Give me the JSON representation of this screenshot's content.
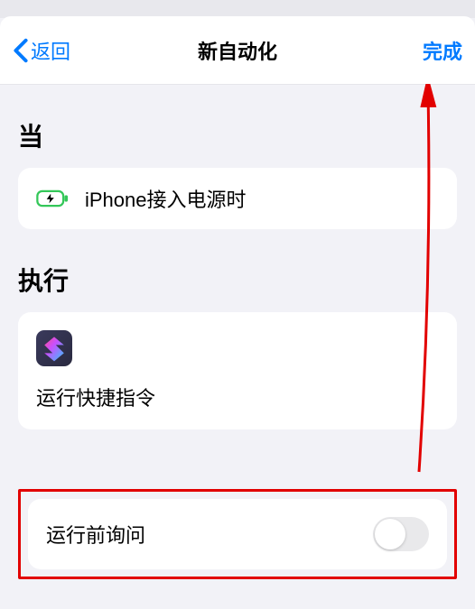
{
  "nav": {
    "back_label": "返回",
    "title": "新自动化",
    "done_label": "完成"
  },
  "sections": {
    "when_header": "当",
    "do_header": "执行"
  },
  "trigger": {
    "label": "iPhone接入电源时"
  },
  "action": {
    "label": "运行快捷指令"
  },
  "ask": {
    "label": "运行前询问",
    "enabled": false
  },
  "colors": {
    "accent": "#007aff",
    "highlight_border": "#e20000",
    "charger_green": "#34c759"
  }
}
